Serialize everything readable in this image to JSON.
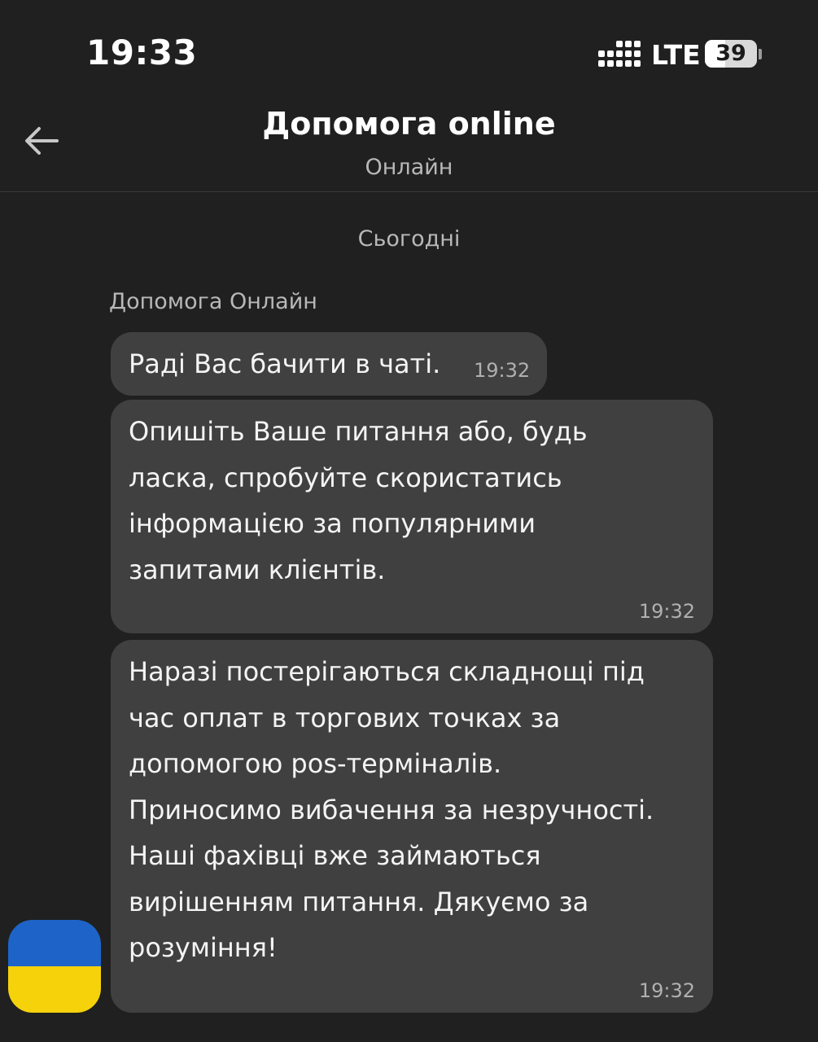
{
  "status_bar": {
    "time": "19:33",
    "network": "LTE",
    "battery": "39",
    "battery_level": 0.39
  },
  "header": {
    "title": "Допомога online",
    "status": "Онлайн",
    "back_icon": "arrow-left-icon"
  },
  "chat": {
    "date_divider": "Сьогодні",
    "sender_name": "Допомога Онлайн",
    "messages": [
      {
        "lines": [
          "Раді Вас бачити в чаті."
        ],
        "time": "19:32"
      },
      {
        "lines": [
          "Опишіть Ваше питання або, будь",
          "ласка, спробуйте скористатись",
          "інформацією за популярними",
          "запитами клієнтів."
        ],
        "time": "19:32"
      },
      {
        "lines": [
          "Наразі постерігаються складнощі під",
          "час оплат в торгових точках за",
          "допомогою pos-терміналів.",
          "Приносимо вибачення за незручності.",
          "Наші фахівці вже займаються",
          "вирішенням питання. Дякуємо за",
          "розуміння!"
        ],
        "time": "19:32"
      }
    ],
    "avatar": {
      "icon": "ukraine-flag-icon",
      "colors": [
        "#1e64c8",
        "#f6d20b"
      ]
    }
  }
}
